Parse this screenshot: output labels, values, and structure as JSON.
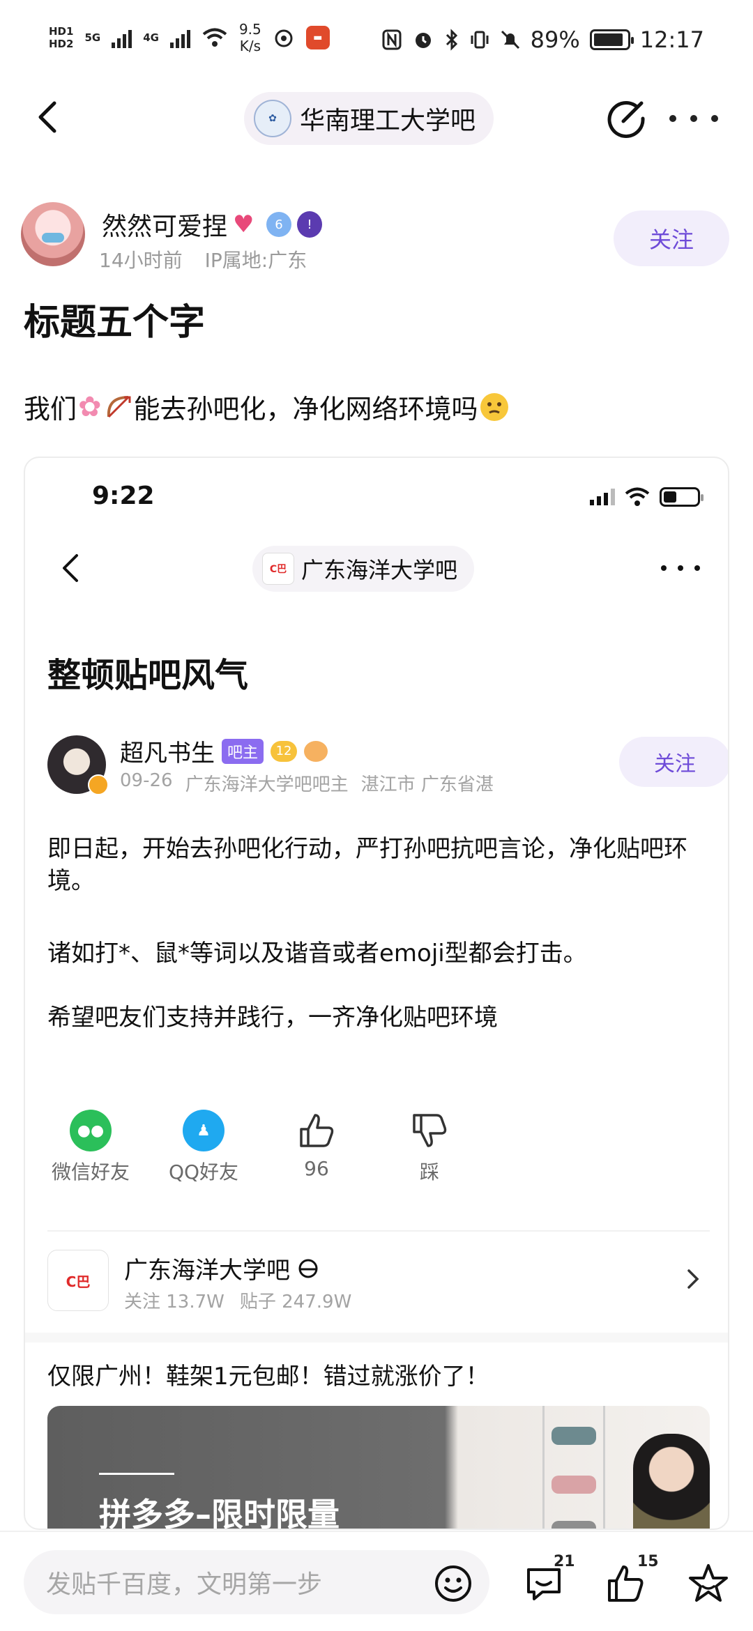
{
  "status_bar": {
    "hd_top": "HD1",
    "hd_bottom": "HD2",
    "net1": "5G",
    "net2": "4G",
    "speed_value": "9.5",
    "speed_unit": "K/s",
    "battery": "89%",
    "battery_level": 0.89,
    "time": "12:17"
  },
  "nav": {
    "forum_name": "华南理工大学吧"
  },
  "post": {
    "author": "然然可爱捏",
    "author_level": "6",
    "time_ago": "14小时前",
    "ip": "IP属地:广东",
    "follow_label": "关注",
    "title": "标题五个字",
    "body_prefix": "我们",
    "body_suffix": "能去孙吧化，净化网络环境吗"
  },
  "screenshot": {
    "time": "9:22",
    "forum_name": "广东海洋大学吧",
    "title": "整顿贴吧风气",
    "author": "超凡书生",
    "role_tag": "吧主",
    "level": "12",
    "date": "09-26",
    "role_desc": "广东海洋大学吧吧主",
    "location": "湛江市 广东省湛",
    "follow_label": "关注",
    "paragraphs": [
      "即日起，开始去孙吧化行动，严打孙吧抗吧言论，净化贴吧环境。",
      "诸如打*、鼠*等词以及谐音或者emoji型都会打击。",
      "希望吧友们支持并践行，一齐净化贴吧环境"
    ],
    "share": {
      "wechat": "微信好友",
      "qq": "QQ好友",
      "likes": "96",
      "dislike": "踩"
    },
    "forum_card": {
      "name": "广东海洋大学吧",
      "follows": "关注 13.7W",
      "posts": "贴子 247.9W"
    },
    "ad": {
      "title": "仅限广州！鞋架1元包邮！错过就涨价了！",
      "banner_text": "拼多多–限时限量"
    }
  },
  "bottom_bar": {
    "placeholder": "发贴千百度，文明第一步",
    "comment_count": "21",
    "like_count": "15"
  },
  "colors": {
    "accent": "#6e4bd8",
    "follow_bg": "#f2eefb"
  }
}
